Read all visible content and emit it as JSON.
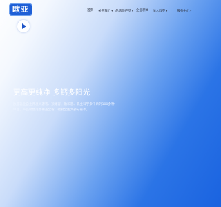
{
  "header": {
    "logo_text": "欧亚",
    "nav": [
      {
        "label": "首页",
        "dropdown": false
      },
      {
        "label": "关于我们",
        "dropdown": true
      },
      {
        "label": "品牌与产品",
        "dropdown": true
      },
      {
        "label": "企业新闻",
        "dropdown": false
      },
      {
        "label": "加入欧亚",
        "dropdown": true
      },
      {
        "label": "服务中心",
        "dropdown": true
      }
    ]
  },
  "hero": {
    "play_icon": "play-icon",
    "title": "更高更纯净 多钙多阳光",
    "description": "欧亚乳业自主开发大游客、顶耀客、融和客、乳业科学多个系列100多种单品，产品销售范围覆盖全省，辐射全国大部分省市。"
  },
  "colors": {
    "gradient_start": "#ffffff",
    "gradient_end": "#1a63e0",
    "brand": "#1e5fd6"
  }
}
